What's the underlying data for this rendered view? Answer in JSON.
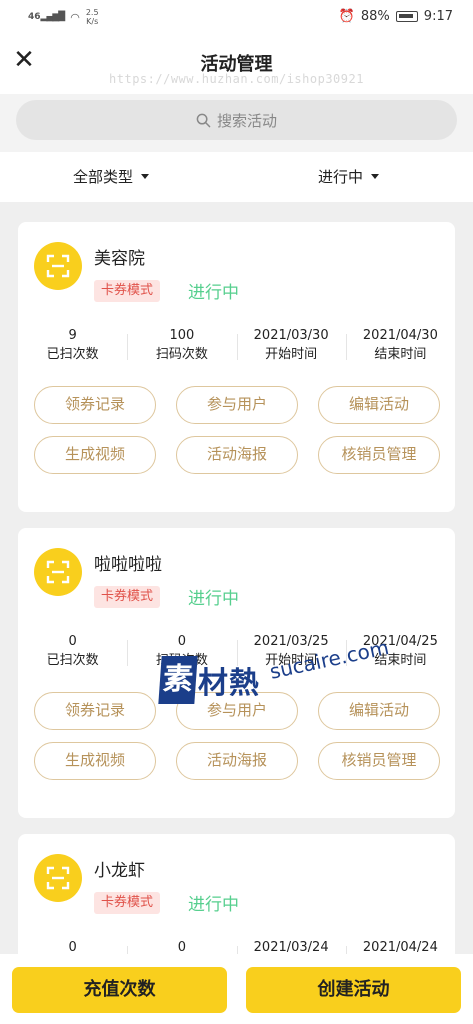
{
  "status_bar": {
    "signal": "46",
    "net_speed_value": "2.5",
    "net_speed_unit": "K/s",
    "battery": "88%",
    "time": "9:17"
  },
  "header": {
    "title": "活动管理",
    "watermark_url": "https://www.huzhan.com/ishop30921"
  },
  "search": {
    "placeholder": "搜索活动"
  },
  "filters": {
    "type": "全部类型",
    "status": "进行中"
  },
  "activities": [
    {
      "name": "美容院",
      "mode": "卡券模式",
      "status": "进行中",
      "stats": [
        {
          "value": "9",
          "label": "已扫次数"
        },
        {
          "value": "100",
          "label": "扫码次数"
        },
        {
          "value": "2021/03/30",
          "label": "开始时间"
        },
        {
          "value": "2021/04/30",
          "label": "结束时间"
        }
      ],
      "buttons": [
        "领券记录",
        "参与用户",
        "编辑活动",
        "生成视频",
        "活动海报",
        "核销员管理"
      ]
    },
    {
      "name": "啦啦啦啦",
      "mode": "卡券模式",
      "status": "进行中",
      "stats": [
        {
          "value": "0",
          "label": "已扫次数"
        },
        {
          "value": "0",
          "label": "扫码次数"
        },
        {
          "value": "2021/03/25",
          "label": "开始时间"
        },
        {
          "value": "2021/04/25",
          "label": "结束时间"
        }
      ],
      "buttons": [
        "领券记录",
        "参与用户",
        "编辑活动",
        "生成视频",
        "活动海报",
        "核销员管理"
      ]
    },
    {
      "name": "小龙虾",
      "mode": "卡券模式",
      "status": "进行中",
      "stats": [
        {
          "value": "0",
          "label": ""
        },
        {
          "value": "0",
          "label": ""
        },
        {
          "value": "2021/03/24",
          "label": ""
        },
        {
          "value": "2021/04/24",
          "label": ""
        }
      ],
      "buttons": []
    }
  ],
  "bottom": {
    "recharge": "充值次数",
    "create": "创建活动"
  },
  "watermark": {
    "logo_square": "素",
    "logo_chars": "材熱",
    "domain": "sucaire.com"
  },
  "colors": {
    "accent_yellow": "#f9cf1d",
    "status_green": "#56cf8e",
    "badge_red": "#e0524a",
    "button_gold": "#b6925a"
  }
}
